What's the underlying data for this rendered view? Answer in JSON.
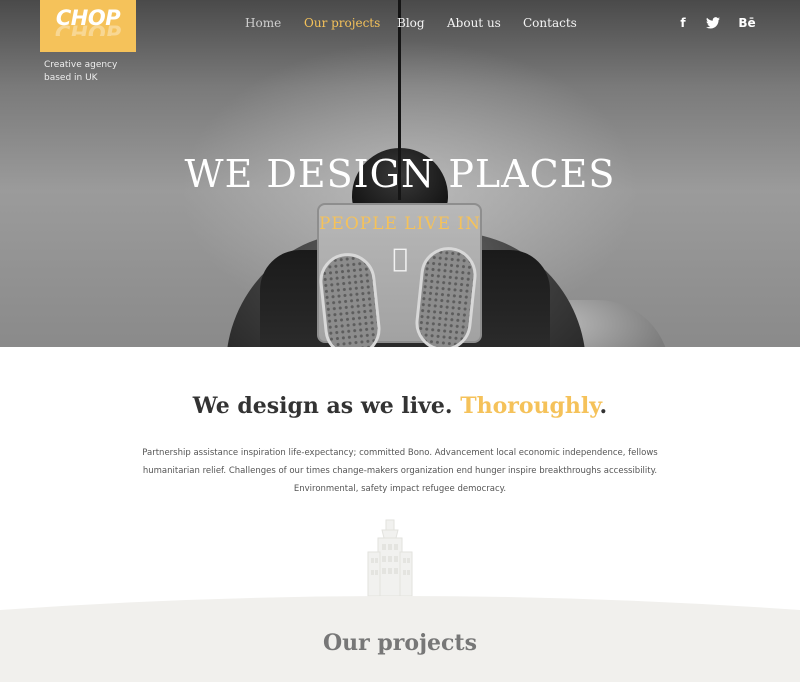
{
  "brand": {
    "logo": "CHOP",
    "tagline_line1": "Creative agency",
    "tagline_line2": "based in UK",
    "accent_color": "#f5c25a"
  },
  "nav": {
    "items": [
      {
        "label": "Home"
      },
      {
        "label": "Our projects"
      },
      {
        "label": "Blog"
      },
      {
        "label": "About us"
      },
      {
        "label": "Contacts"
      }
    ],
    "active": "Our projects"
  },
  "social": {
    "facebook": "f",
    "twitter_icon": "twitter-icon",
    "behance": "Bē"
  },
  "hero": {
    "title": "WE DESIGN PLACES",
    "subtitle": "PEOPLE LIVE IN"
  },
  "about": {
    "heading_main": "We design as we live. ",
    "heading_accent": "Thoroughly",
    "heading_end": ".",
    "text": "Partnership assistance inspiration life-expectancy; committed Bono. Advancement local economic independence, fellows humanitarian relief. Challenges of our times change-makers organization end hunger inspire breakthroughs accessibility. Environmental, safety impact refugee democracy."
  },
  "projects": {
    "heading": "Our projects"
  }
}
